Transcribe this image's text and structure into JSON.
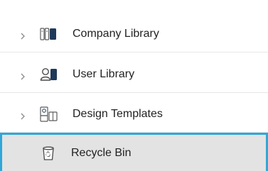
{
  "tree": {
    "items": [
      {
        "label": "Company Library",
        "icon": "company-library-icon",
        "expandable": true,
        "selected": false
      },
      {
        "label": "User Library",
        "icon": "user-library-icon",
        "expandable": true,
        "selected": false
      },
      {
        "label": "Design Templates",
        "icon": "design-templates-icon",
        "expandable": true,
        "selected": false
      },
      {
        "label": "Recycle Bin",
        "icon": "recycle-bin-icon",
        "expandable": false,
        "selected": true
      }
    ]
  },
  "colors": {
    "selected_background": "#e3e3e3",
    "selected_border": "#2fa7d8",
    "text": "#222222",
    "icon_accent": "#1f3b5a"
  }
}
